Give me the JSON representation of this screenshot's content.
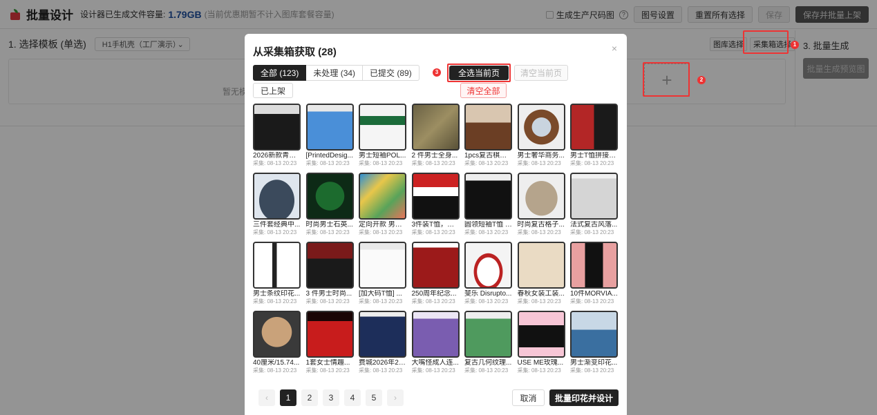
{
  "app": {
    "title": "批量设计",
    "capacity_label": "设计器已生成文件容量:",
    "capacity_value": "1.79GB",
    "capacity_note": "(当前优惠期暂不计入图库套餐容量)"
  },
  "toolbar": {
    "gen_size_chart": "生成生产尺码图",
    "number_settings": "图号设置",
    "reset_all": "重置所有选择",
    "save": "保存",
    "save_and_list": "保存并批量上架"
  },
  "step1": {
    "title": "1. 选择模板 (单选)",
    "template_select": "H1手机壳（工厂演示）",
    "empty_text": "暂无模"
  },
  "source_buttons": {
    "gallery": "图库选择",
    "collection": "采集箱选择"
  },
  "step3": {
    "title": "3. 批量生成",
    "preview_button": "批量生成预览图"
  },
  "add_symbol": "+",
  "markers": [
    "1",
    "2",
    "3"
  ],
  "modal": {
    "title": "从采集箱获取 (28)",
    "close": "×",
    "tabs": [
      {
        "label": "全部 (123)",
        "active": true
      },
      {
        "label": "未处理 (34)",
        "active": false
      },
      {
        "label": "已提交 (89)",
        "active": false
      }
    ],
    "tab_listed": "已上架",
    "select_page": "全选当前页",
    "clear_page": "清空当前页",
    "clear_all": "清空全部",
    "items": [
      {
        "name": "2026新款青少...",
        "time": "采集: 08-13 20:23"
      },
      {
        "name": "[PrintedDesig...",
        "time": "采集: 08-13 20:23"
      },
      {
        "name": "男士短袖POL...",
        "time": "采集: 08-13 20:23"
      },
      {
        "name": "2 件男士全身...",
        "time": "采集: 08-13 20:23"
      },
      {
        "name": "1pcs复古棋盘...",
        "time": "采集: 08-13 20:23"
      },
      {
        "name": "男士奢华商务...",
        "time": "采集: 08-13 20:23"
      },
      {
        "name": "男士T恤拼接双...",
        "time": "采集: 08-13 20:23"
      },
      {
        "name": "三件套经典中...",
        "time": "采集: 08-13 20:23"
      },
      {
        "name": "时尚男士石英...",
        "time": "采集: 08-13 20:23"
      },
      {
        "name": "定向开款 男式...",
        "time": "采集: 08-13 20:23"
      },
      {
        "name": "3件装T恤，鲜...",
        "time": "采集: 08-13 20:23"
      },
      {
        "name": "圆领短袖T恤 \"...",
        "time": "采集: 08-13 20:23"
      },
      {
        "name": "时尚复古格子...",
        "time": "采集: 08-13 20:23"
      },
      {
        "name": "法式复古风落...",
        "time": "采集: 08-13 20:23"
      },
      {
        "name": "男士条纹印花...",
        "time": "采集: 08-13 20:23"
      },
      {
        "name": "3 件男士时尚...",
        "time": "采集: 08-13 20:23"
      },
      {
        "name": "[加大码T恤] ...",
        "time": "采集: 08-13 20:23"
      },
      {
        "name": "250周年纪念...",
        "time": "采集: 08-13 20:23"
      },
      {
        "name": "斐乐 Disrupto...",
        "time": "采集: 08-13 20:23"
      },
      {
        "name": "春秋女装工装...",
        "time": "采集: 08-13 20:23"
      },
      {
        "name": "10件MORVIA...",
        "time": "采集: 08-13 20:23"
      },
      {
        "name": "40厘米/15.74...",
        "time": "采集: 08-13 20:23"
      },
      {
        "name": "1套女士情趣...",
        "time": "采集: 08-13 20:23"
      },
      {
        "name": "费城2026年23...",
        "time": "采集: 08-13 20:23"
      },
      {
        "name": "大嘴怪成人连...",
        "time": "采集: 08-13 20:23"
      },
      {
        "name": "复古几何纹理...",
        "time": "采集: 08-13 20:23"
      },
      {
        "name": "USE ME玫瑰...",
        "time": "采集: 08-13 20:23"
      },
      {
        "name": "男士渐变印花...",
        "time": "采集: 08-13 20:23"
      }
    ],
    "pagination": {
      "prev": "‹",
      "pages": [
        "1",
        "2",
        "3",
        "4",
        "5"
      ],
      "current": "1",
      "next": "›"
    },
    "cancel": "取消",
    "confirm": "批量印花并设计"
  },
  "colors": {
    "primary": "#222222",
    "danger": "#e33333",
    "capacity": "#1e50a0"
  }
}
